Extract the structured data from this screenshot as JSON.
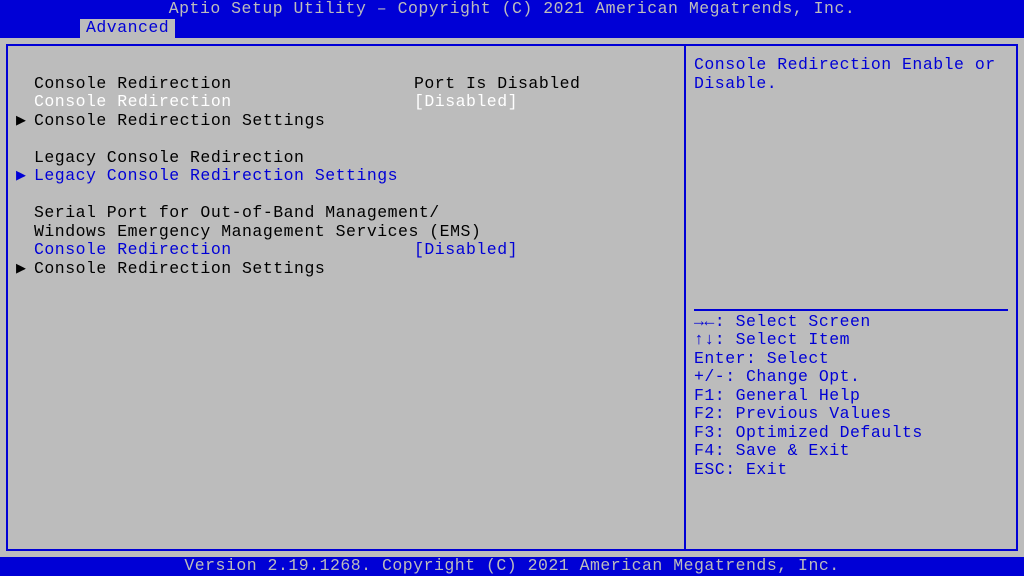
{
  "title": "Aptio Setup Utility – Copyright (C) 2021 American Megatrends, Inc.",
  "tab": "Advanced",
  "footer": "Version 2.19.1268. Copyright (C) 2021 American Megatrends, Inc.",
  "help": {
    "description": "Console Redirection Enable or Disable.",
    "keys": {
      "select_screen": "→←: Select Screen",
      "select_item": "↑↓: Select Item",
      "enter": "Enter: Select",
      "change": "+/-: Change Opt.",
      "f1": "F1: General Help",
      "f2": "F2: Previous Values",
      "f3": "F3: Optimized Defaults",
      "f4": "F4: Save & Exit",
      "esc": "ESC: Exit"
    }
  },
  "items": {
    "blank0": "",
    "cr_status_label": "Console Redirection",
    "cr_status_value": "Port Is Disabled",
    "cr_toggle_label": "Console Redirection",
    "cr_toggle_value": "[Disabled]",
    "cr_settings": "Console Redirection Settings",
    "blank1": "",
    "legacy_header": "Legacy Console Redirection",
    "legacy_settings": "Legacy Console Redirection Settings",
    "blank2": "",
    "serial_header1": "Serial Port for Out-of-Band Management/",
    "serial_header2": "Windows Emergency Management Services (EMS)",
    "serial_cr_label": "Console Redirection",
    "serial_cr_value": "[Disabled]",
    "serial_settings": "Console Redirection Settings"
  },
  "glyph": {
    "tri": "▶"
  }
}
